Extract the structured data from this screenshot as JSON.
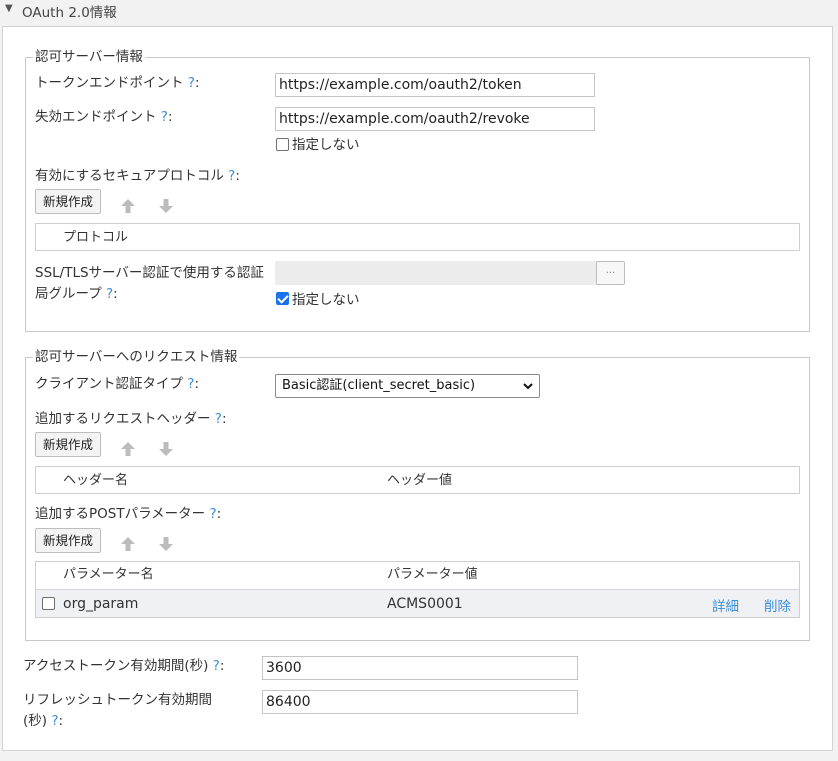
{
  "section": {
    "title": "OAuth 2.0情報",
    "toggle_icon": "triangle-down-icon"
  },
  "auth_server": {
    "legend": "認可サーバー情報",
    "token_endpoint": {
      "label": "トークンエンドポイント",
      "help": "?",
      "colon": ":",
      "value": "https://example.com/oauth2/token"
    },
    "revoke_endpoint": {
      "label": "失効エンドポイント",
      "help": "?",
      "colon": ":",
      "value": "https://example.com/oauth2/revoke",
      "unspecified_label": "指定しない",
      "unspecified_checked": false
    },
    "protocols": {
      "label": "有効にするセキュアプロトコル",
      "help": "?",
      "colon": ":",
      "new_button": "新規作成",
      "column": "プロトコル"
    },
    "ca_group": {
      "label_line1": "SSL/TLSサーバー認証で使用する認証",
      "label_line2": "局グループ",
      "help": "?",
      "colon": ":",
      "value": "",
      "browse_button": "···",
      "unspecified_label": "指定しない",
      "unspecified_checked": true
    }
  },
  "request_info": {
    "legend": "認可サーバーへのリクエスト情報",
    "client_auth": {
      "label": "クライアント認証タイプ",
      "help": "?",
      "colon": ":",
      "selected": "Basic認証(client_secret_basic)"
    },
    "headers": {
      "label": "追加するリクエストヘッダー",
      "help": "?",
      "colon": ":",
      "new_button": "新規作成",
      "columns": [
        "ヘッダー名",
        "ヘッダー値"
      ]
    },
    "post_params": {
      "label": "追加するPOSTパラメーター",
      "help": "?",
      "colon": ":",
      "new_button": "新規作成",
      "columns": [
        "パラメーター名",
        "パラメーター値"
      ],
      "rows": [
        {
          "name": "org_param",
          "value": "ACMS0001",
          "detail": "詳細",
          "delete": "削除"
        }
      ]
    }
  },
  "access_token_ttl": {
    "label": "アクセストークン有効期間(秒)",
    "help": "?",
    "colon": ":",
    "value": "3600"
  },
  "refresh_token_ttl": {
    "label_line1": "リフレッシュトークン有効期間",
    "label_line2": "(秒)",
    "help": "?",
    "colon": ":",
    "value": "86400"
  },
  "colors": {
    "help_link": "#3b8ed8",
    "checkbox_checked": "#1a73e8",
    "row_bg": "#f0f1f5"
  }
}
